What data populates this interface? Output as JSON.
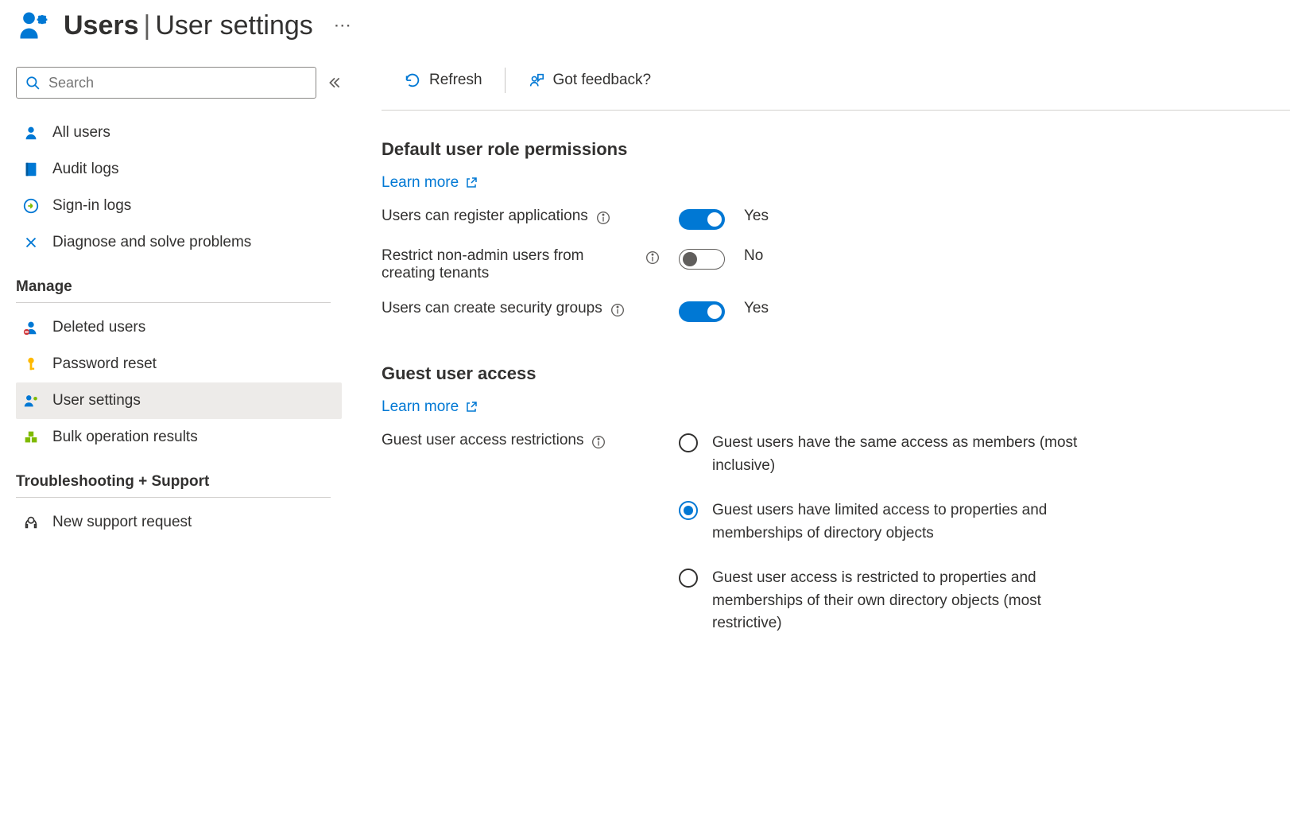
{
  "header": {
    "title_main": "Users",
    "title_sub": "User settings"
  },
  "search": {
    "placeholder": "Search"
  },
  "sidebar": {
    "items": [
      {
        "label": "All users"
      },
      {
        "label": "Audit logs"
      },
      {
        "label": "Sign-in logs"
      },
      {
        "label": "Diagnose and solve problems"
      }
    ],
    "sections": [
      {
        "header": "Manage",
        "items": [
          {
            "label": "Deleted users"
          },
          {
            "label": "Password reset"
          },
          {
            "label": "User settings",
            "selected": true
          },
          {
            "label": "Bulk operation results"
          }
        ]
      },
      {
        "header": "Troubleshooting + Support",
        "items": [
          {
            "label": "New support request"
          }
        ]
      }
    ]
  },
  "toolbar": {
    "refresh": "Refresh",
    "feedback": "Got feedback?"
  },
  "sections": {
    "default_perms": {
      "title": "Default user role permissions",
      "learn_more": "Learn more",
      "settings": [
        {
          "label": "Users can register applications",
          "on": true,
          "value": "Yes"
        },
        {
          "label": "Restrict non-admin users from creating tenants",
          "on": false,
          "value": "No"
        },
        {
          "label": "Users can create security groups",
          "on": true,
          "value": "Yes"
        }
      ]
    },
    "guest": {
      "title": "Guest user access",
      "learn_more": "Learn more",
      "setting_label": "Guest user access restrictions",
      "options": [
        {
          "label": "Guest users have the same access as members (most inclusive)",
          "checked": false
        },
        {
          "label": "Guest users have limited access to properties and memberships of directory objects",
          "checked": true
        },
        {
          "label": "Guest user access is restricted to properties and memberships of their own directory objects (most restrictive)",
          "checked": false
        }
      ]
    }
  }
}
